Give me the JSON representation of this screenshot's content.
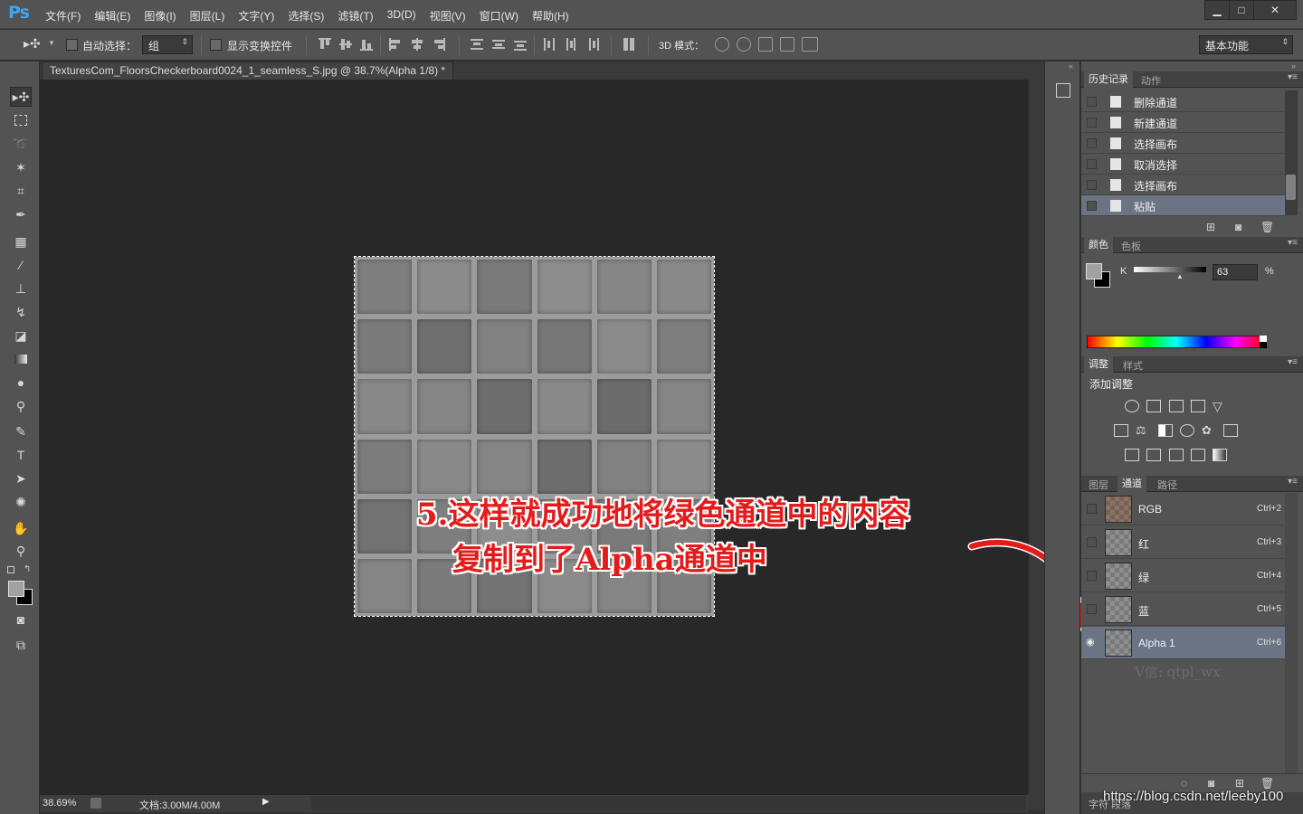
{
  "app": {
    "logo": "Ps",
    "menus": [
      "文件(F)",
      "编辑(E)",
      "图像(I)",
      "图层(L)",
      "文字(Y)",
      "选择(S)",
      "滤镜(T)",
      "3D(D)",
      "视图(V)",
      "窗口(W)",
      "帮助(H)"
    ],
    "window_controls": {
      "minimize": "▁",
      "maximize": "□",
      "close": "✕"
    }
  },
  "options": {
    "auto_select_label": "自动选择：",
    "auto_select_value": "组",
    "show_transform_label": "显示变换控件",
    "mode_3d_label": "3D 模式：",
    "workspace": "基本功能"
  },
  "document": {
    "tab_title": "TexturesCom_FloorsCheckerboard0024_1_seamless_S.jpg @ 38.7%(Alpha 1/8) *",
    "zoom": "38.69%",
    "doc_size": "文档:3.00M/4.00M",
    "tile_shades": [
      "#7f7f7f",
      "#8c8c8c",
      "#7a7a7a",
      "#8d8d8d",
      "#868686",
      "#8a8a8a",
      "#7b7b7b",
      "#6f6f6f",
      "#818181",
      "#777777",
      "#8b8b8b",
      "#7e7e7e",
      "#888888",
      "#858585",
      "#6e6e6e",
      "#8a8a8a",
      "#6c6c6c",
      "#858585",
      "#7c7c7c",
      "#8a8a8a",
      "#858585",
      "#6e6e6e",
      "#818181",
      "#8c8c8c",
      "#727272",
      "#7e7e7e",
      "#8d8d8d",
      "#838383",
      "#7a7a7a",
      "#7f7f7f",
      "#858585",
      "#7b7b7b",
      "#737373",
      "#8b8b8b",
      "#858585",
      "#7e7e7e"
    ]
  },
  "annotation": {
    "line1": "5.这样就成功地将绿色通道中的内容",
    "line2": "复制到了Alpha通道中"
  },
  "history_panel": {
    "tabs": [
      "历史记录",
      "动作"
    ],
    "items": [
      "删除通道",
      "新建通道",
      "选择画布",
      "取消选择",
      "选择画布",
      "粘贴"
    ]
  },
  "color_panel": {
    "tabs": [
      "颜色",
      "色板"
    ],
    "channel": "K",
    "value": "63",
    "unit": "%",
    "fg_color": "#a1a1a1",
    "bg_color": "#000000"
  },
  "adjust_panel": {
    "tabs": [
      "调整",
      "样式"
    ],
    "title": "添加调整"
  },
  "channels_panel": {
    "tabs": [
      "图层",
      "通道",
      "路径"
    ],
    "channels": [
      {
        "name": "RGB",
        "key": "Ctrl+2"
      },
      {
        "name": "红",
        "key": "Ctrl+3"
      },
      {
        "name": "绿",
        "key": "Ctrl+4"
      },
      {
        "name": "蓝",
        "key": "Ctrl+5"
      },
      {
        "name": "Alpha 1",
        "key": "Ctrl+6"
      }
    ],
    "watermark": "V信: qtpl_wx"
  },
  "bottom_tabs": "字符  段落",
  "url_watermark": "https://blog.csdn.net/leeby100"
}
